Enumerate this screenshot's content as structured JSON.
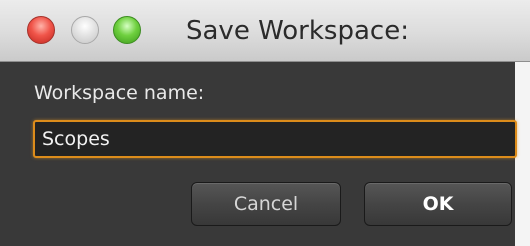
{
  "window": {
    "title": "Save Workspace:"
  },
  "traffic_lights": [
    {
      "name": "close",
      "color": "#f0554a"
    },
    {
      "name": "minimize",
      "color": "#d8d8d8"
    },
    {
      "name": "zoom",
      "color": "#6fd03f"
    }
  ],
  "form": {
    "label": "Workspace name:",
    "value": "Scopes"
  },
  "buttons": {
    "cancel_label": "Cancel",
    "ok_label": "OK"
  },
  "colors": {
    "body_background": "#393939",
    "focus_ring": "#dc8c1b",
    "titlebar": "#dcdcdc"
  }
}
